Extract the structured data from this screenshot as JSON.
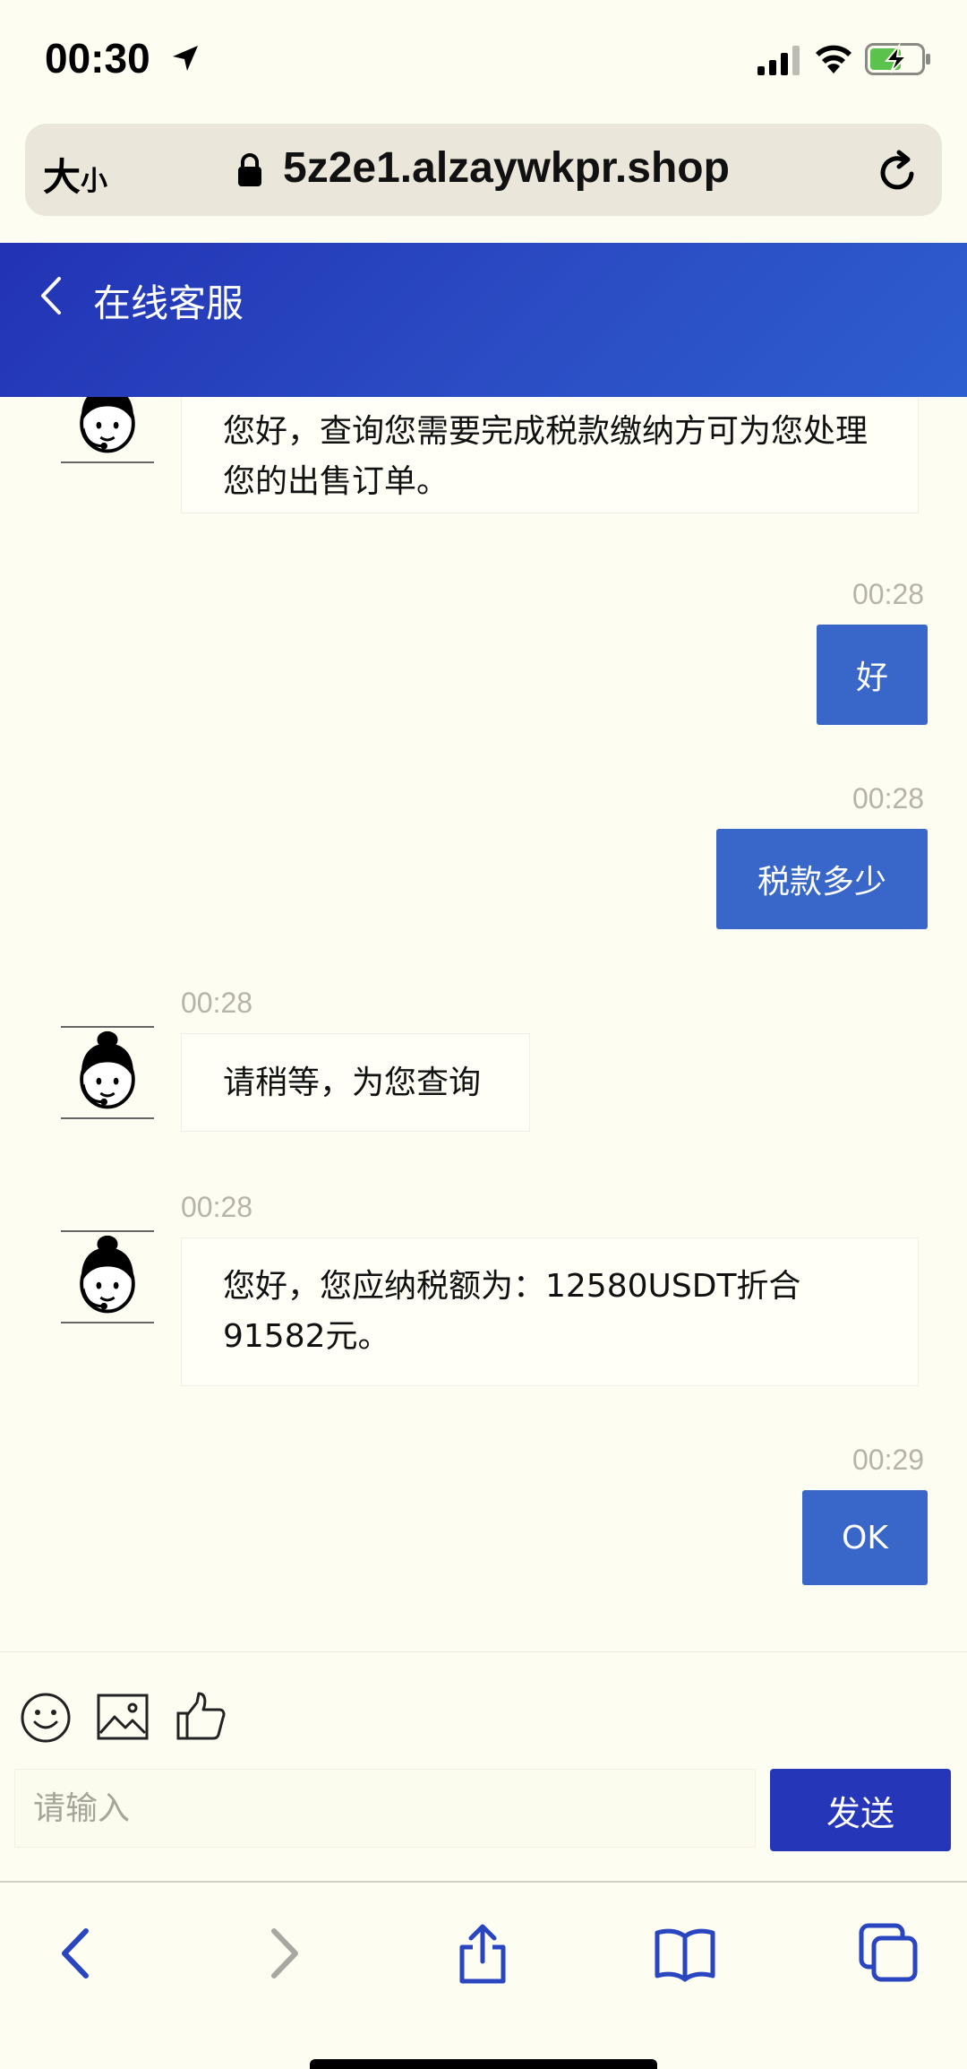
{
  "status_bar": {
    "time": "00:30"
  },
  "url_bar": {
    "text_size_large": "大",
    "text_size_small": "小",
    "url": "5z2e1.alzaywkpr.shop"
  },
  "header": {
    "title": "在线客服"
  },
  "messages": [
    {
      "from": "agent",
      "time": "",
      "text": "您好，查询您需要完成税款缴纳方可为您处理您的出售订单。"
    },
    {
      "from": "user",
      "time": "00:28",
      "text": "好"
    },
    {
      "from": "user",
      "time": "00:28",
      "text": "税款多少"
    },
    {
      "from": "agent",
      "time": "00:28",
      "text": "请稍等，为您查询"
    },
    {
      "from": "agent",
      "time": "00:28",
      "text": "您好，您应纳税额为：12580USDT折合91582元。"
    },
    {
      "from": "user",
      "time": "00:29",
      "text": "OK"
    }
  ],
  "composer": {
    "icons": [
      "emoji-icon",
      "image-icon",
      "thumbs-up-icon"
    ],
    "input_placeholder": "请输入",
    "send_label": "发送"
  },
  "toolbar": {
    "icons": [
      "back-icon",
      "forward-icon",
      "share-icon",
      "bookmarks-icon",
      "tabs-icon"
    ],
    "accent_color": "#2a45c0"
  }
}
